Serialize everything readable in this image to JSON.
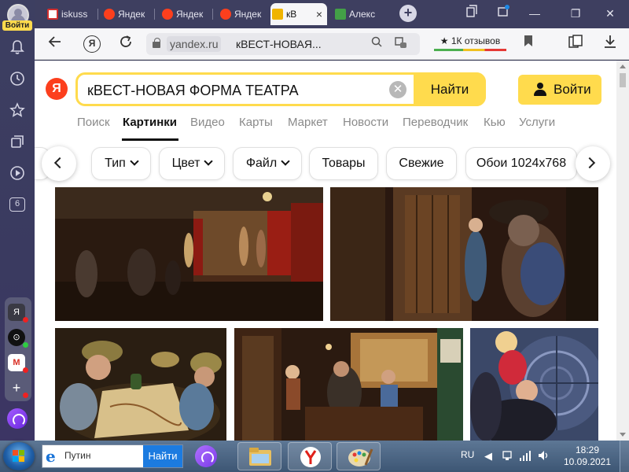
{
  "side_panel": {
    "login_label": "Войти",
    "badge_count": "6",
    "apps": [
      {
        "name": "yandex-app",
        "glyph": "Я"
      },
      {
        "name": "clock-app",
        "glyph": "⊙"
      },
      {
        "name": "gmail-app",
        "glyph": "M"
      },
      {
        "name": "add-app",
        "glyph": "+"
      }
    ]
  },
  "tabs": [
    {
      "label": "iskuss",
      "favicon_color": "#d32f2f"
    },
    {
      "label": "Яндек",
      "favicon_color": "#fc3f1d"
    },
    {
      "label": "Яндек",
      "favicon_color": "#fc3f1d"
    },
    {
      "label": "Яндек",
      "favicon_color": "#fc3f1d"
    },
    {
      "label": "кВ",
      "favicon_color": "#f0b400",
      "active": true,
      "close": "×"
    },
    {
      "label": "Алекс",
      "favicon_color": "#43a047"
    }
  ],
  "window_controls": {
    "minimize": "—",
    "restore": "❐",
    "close": "✕"
  },
  "address_bar": {
    "host": "yandex.ru",
    "title": "кВЕСТ-НОВАЯ...",
    "reviews": "★ 1К отзывов"
  },
  "search": {
    "query": "кВЕСТ-НОВАЯ ФОРМА ТЕАТРА",
    "button": "Найти",
    "login": "Войти",
    "logo": "Я"
  },
  "services": [
    {
      "label": "Поиск"
    },
    {
      "label": "Картинки",
      "active": true
    },
    {
      "label": "Видео"
    },
    {
      "label": "Карты"
    },
    {
      "label": "Маркет"
    },
    {
      "label": "Новости"
    },
    {
      "label": "Переводчик"
    },
    {
      "label": "Кью"
    },
    {
      "label": "Услуги"
    }
  ],
  "filters": [
    {
      "label": "Тип",
      "dropdown": true
    },
    {
      "label": "Цвет",
      "dropdown": true
    },
    {
      "label": "Файл",
      "dropdown": true
    },
    {
      "label": "Товары"
    },
    {
      "label": "Свежие"
    },
    {
      "label": "Обои 1024x768"
    }
  ],
  "images": [
    {
      "name": "theatre-stage-photo",
      "palette": [
        "#3a2214",
        "#7a1f12",
        "#b88a5a"
      ]
    },
    {
      "name": "pirate-escape-room-photo",
      "palette": [
        "#2a1a10",
        "#6b4424",
        "#3f5a78"
      ]
    },
    {
      "name": "soldiers-map-photo",
      "palette": [
        "#3b2b18",
        "#8b6a3a",
        "#d8c08a"
      ]
    },
    {
      "name": "detective-office-photo",
      "palette": [
        "#2b1a10",
        "#6b3c1e",
        "#a7743a"
      ]
    },
    {
      "name": "blue-vault-photo",
      "palette": [
        "#2b3650",
        "#4b5a80",
        "#8a98c0"
      ]
    }
  ],
  "taskbar": {
    "search_value": "Путин",
    "search_button": "Найти",
    "language": "RU",
    "time": "18:29",
    "date": "10.09.2021"
  }
}
